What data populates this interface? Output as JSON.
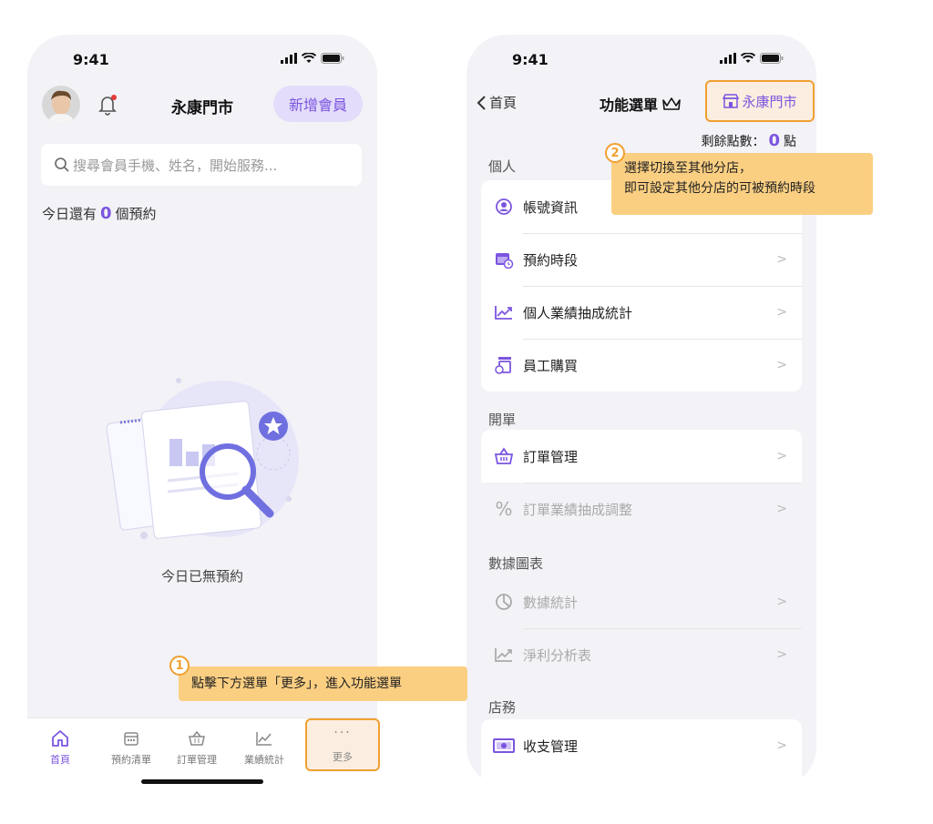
{
  "home_screen": {
    "status_time": "9:41",
    "store_name": "永康門市",
    "add_member_label": "新增會員",
    "search_placeholder": "搜尋會員手機、姓名，開始服務...",
    "today_prefix": "今日還有",
    "today_count": "0",
    "today_suffix": "個預約",
    "empty_text": "今日已無預約",
    "tabs": [
      {
        "label": "首頁",
        "icon": "home-icon",
        "active": true
      },
      {
        "label": "預約清單",
        "icon": "calendar-icon",
        "active": false
      },
      {
        "label": "訂單管理",
        "icon": "basket-icon",
        "active": false
      },
      {
        "label": "業績統計",
        "icon": "chart-icon",
        "active": false
      },
      {
        "label": "更多",
        "icon": "more-icon",
        "active": false
      }
    ]
  },
  "menu_screen": {
    "status_time": "9:41",
    "back_label": "首頁",
    "title": "功能選單",
    "store_switch_label": "永康門市",
    "points_label": "剩餘點數：",
    "points_value": "0",
    "points_unit": "點",
    "sections": [
      {
        "label": "個人",
        "items": [
          {
            "label": "帳號資訊",
            "icon": "user-circle-icon"
          },
          {
            "label": "預約時段",
            "icon": "calendar-clock-icon"
          },
          {
            "label": "個人業績抽成統計",
            "icon": "trend-icon"
          },
          {
            "label": "員工購買",
            "icon": "staff-purchase-icon"
          }
        ]
      },
      {
        "label": "開單",
        "items": [
          {
            "label": "訂單管理",
            "icon": "basket-icon"
          },
          {
            "label": "訂單業績抽成調整",
            "icon": "percent-icon",
            "disabled": true
          }
        ]
      },
      {
        "label": "數據圖表",
        "items": [
          {
            "label": "數據統計",
            "icon": "pie-icon",
            "disabled": true
          },
          {
            "label": "淨利分析表",
            "icon": "trend-icon",
            "disabled": true
          }
        ]
      },
      {
        "label": "店務",
        "items": [
          {
            "label": "收支管理",
            "icon": "cash-icon"
          }
        ]
      }
    ]
  },
  "annotations": {
    "step1_number": "1",
    "step1_text": "點擊下方選單「更多」，進入功能選單",
    "step2_number": "2",
    "step2_line1": "選擇切換至其他分店，",
    "step2_line2": "即可設定其他分店的可被預約時段"
  },
  "colors": {
    "accent": "#7b55e0",
    "highlight": "#f0a030",
    "callout": "#fbcf82"
  }
}
